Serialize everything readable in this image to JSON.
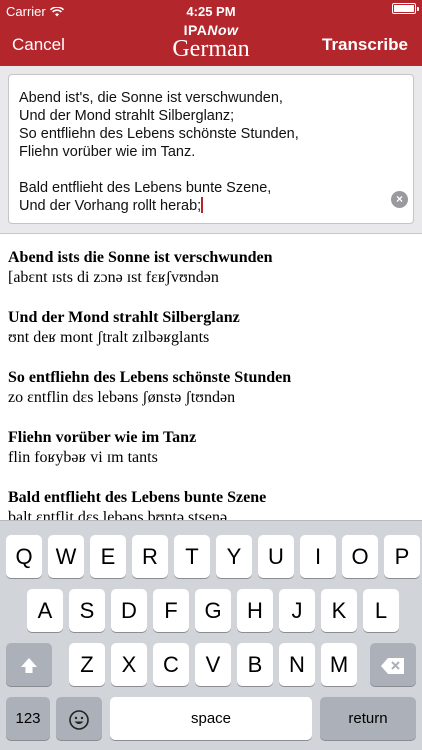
{
  "status": {
    "carrier": "Carrier",
    "time": "4:25 PM",
    "battery_level": 1.0
  },
  "nav": {
    "left_label": "Cancel",
    "brand_a": "IPA",
    "brand_b": "Now",
    "title": "German",
    "right_label": "Transcribe"
  },
  "editor": {
    "lines": [
      "Abend ist's, die Sonne ist verschwunden,",
      "Und der Mond strahlt Silberglanz;",
      "So entfliehn des Lebens schönste Stunden,",
      "Fliehn vorüber wie im Tanz.",
      "",
      "Bald entflieht des Lebens bunte Szene,",
      "Und der Vorhang rollt herab;"
    ],
    "clear_glyph": "×"
  },
  "results": [
    {
      "word": "Abend ists die Sonne ist verschwunden",
      "ipa": "[abɛnt ɪsts di zɔnə ɪst fɛʁʃvʊndən"
    },
    {
      "word": "Und der Mond strahlt Silberglanz",
      "ipa": "ʊnt deʁ mont ʃtralt zɪlbəʁglants"
    },
    {
      "word": "So entfliehn des Lebens schönste Stunden",
      "ipa": "zo ɛntflin dɛs lebəns ʃønstə ʃtʊndən"
    },
    {
      "word": "Fliehn vorüber wie im Tanz",
      "ipa": "flin foʁybəʁ vi ɪm tants"
    },
    {
      "word": "Bald entflieht des Lebens bunte Szene",
      "ipa": "balt ɛntflit dɛs lebəns bʊntə stsenə"
    }
  ],
  "keyboard": {
    "row1": [
      "Q",
      "W",
      "E",
      "R",
      "T",
      "Y",
      "U",
      "I",
      "O",
      "P"
    ],
    "row2": [
      "A",
      "S",
      "D",
      "F",
      "G",
      "H",
      "J",
      "K",
      "L"
    ],
    "row3": [
      "Z",
      "X",
      "C",
      "V",
      "B",
      "N",
      "M"
    ],
    "shift_icon": "shift-icon",
    "delete_icon": "delete-icon",
    "numbers_label": "123",
    "emoji_icon": "emoji-icon",
    "space_label": "space",
    "return_label": "return"
  }
}
